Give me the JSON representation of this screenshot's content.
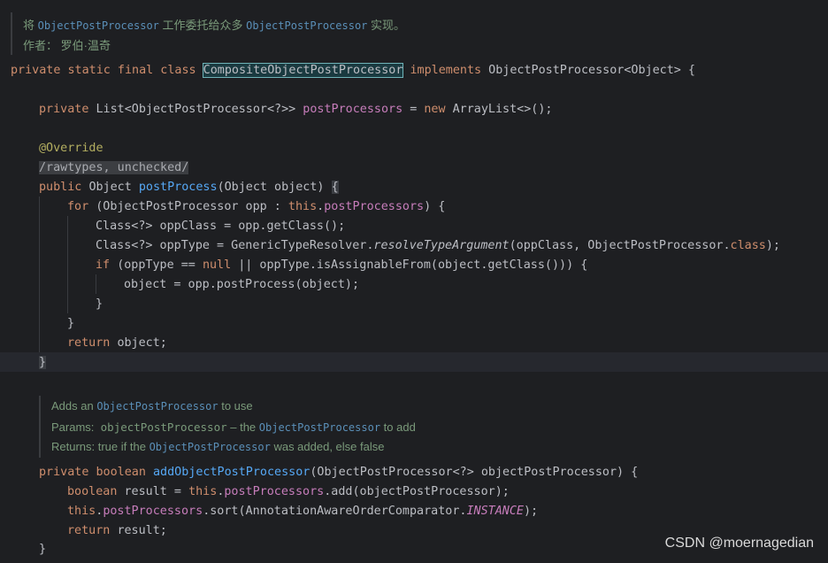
{
  "header_doc": {
    "line1": {
      "pre": "将 ",
      "ref1": "ObjectPostProcessor",
      "mid": " 工作委托给众多 ",
      "ref2": "ObjectPostProcessor",
      "post": " 实现。"
    },
    "line2": "作者： 罗伯·温奇"
  },
  "class_decl": {
    "kw": "private static final class ",
    "name": "CompositeObjectPostProcessor",
    "impl_kw": " implements ",
    "iface": "ObjectPostProcessor<Object> {"
  },
  "field": {
    "kw": "private ",
    "type": "List<ObjectPostProcessor<?>> ",
    "name": "postProcessors",
    "eq": " = ",
    "new_kw": "new ",
    "init": "ArrayList<>();"
  },
  "annotation": "@Override",
  "suppress": "/rawtypes, unchecked/",
  "method1": {
    "kw": "public ",
    "type": "Object ",
    "name": "postProcess",
    "params": "(Object object) ",
    "brace": "{"
  },
  "for_line": {
    "kw": "for ",
    "a": "(ObjectPostProcessor opp : ",
    "this_kw": "this",
    "dot": ".",
    "field": "postProcessors",
    "b": ") {"
  },
  "class_line": "Class<?> oppClass = opp.getClass();",
  "type_line": {
    "a": "Class<?> oppType = GenericTypeResolver.",
    "method": "resolveTypeArgument",
    "b": "(oppClass, ObjectPostProcessor.",
    "cls_kw": "class",
    "c": ");"
  },
  "if_line": {
    "kw": "if ",
    "a": "(oppType == ",
    "null_kw": "null",
    "b": " || oppType.isAssignableFrom(object.getClass())) {"
  },
  "assign_line": "object = opp.postProcess(object);",
  "close_inner": "}",
  "close_for": "}",
  "return1": {
    "kw": "return ",
    "val": "object;"
  },
  "close_method1": "}",
  "method_doc": {
    "line1": {
      "pre": "Adds an ",
      "ref": "ObjectPostProcessor",
      "post": " to use"
    },
    "line2": {
      "label": "Params: ",
      "param": "objectPostProcessor",
      "mid": " – the ",
      "ref": "ObjectPostProcessor",
      "post": " to add"
    },
    "line3": {
      "pre": "Returns: true if the ",
      "ref": "ObjectPostProcessor",
      "post": " was added, else false"
    }
  },
  "method2": {
    "kw": "private boolean ",
    "name": "addObjectPostProcessor",
    "params": "(ObjectPostProcessor<?> objectPostProcessor) {"
  },
  "bool_line": {
    "kw": "boolean ",
    "a": "result = ",
    "this_kw": "this",
    "dot": ".",
    "field": "postProcessors",
    "b": ".add(objectPostProcessor);"
  },
  "sort_line": {
    "this_kw": "this",
    "dot": ".",
    "field": "postProcessors",
    "a": ".sort(AnnotationAwareOrderComparator.",
    "const": "INSTANCE",
    "b": ");"
  },
  "return2": {
    "kw": "return ",
    "val": "result;"
  },
  "close_method2": "}",
  "watermark": "CSDN @moernagedian"
}
